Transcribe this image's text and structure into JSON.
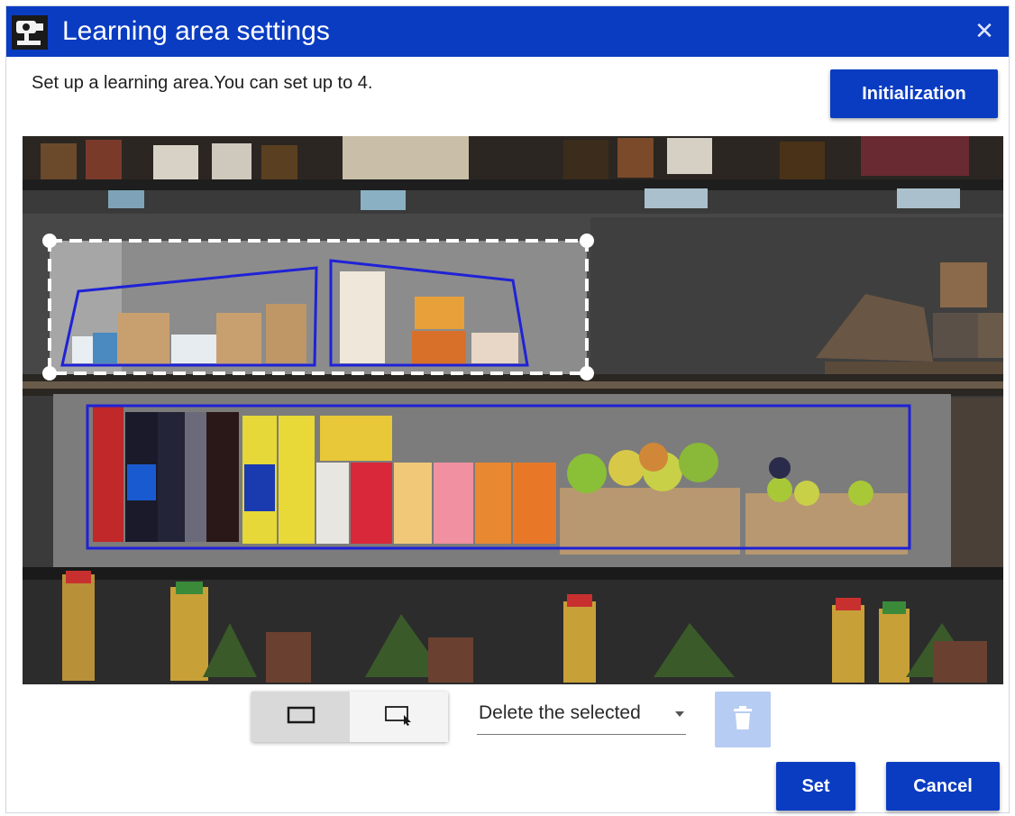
{
  "window": {
    "title": "Learning area settings",
    "close_icon": "close-icon",
    "app_icon": "camera-settings-icon"
  },
  "instruction": "Set up a learning area.You can set up to 4.",
  "buttons": {
    "initialization": "Initialization",
    "set": "Set",
    "cancel": "Cancel"
  },
  "canvas": {
    "image": "store-shelf-camera-view",
    "regions": [
      {
        "name": "learning-area-1",
        "shape": "polygon",
        "color": "#1f22d6"
      },
      {
        "name": "learning-area-2",
        "shape": "polygon",
        "color": "#1f22d6"
      },
      {
        "name": "learning-area-3",
        "shape": "rectangle",
        "color": "#1f22d6"
      },
      {
        "name": "selection-box",
        "shape": "dashed-rectangle",
        "color": "#ffffff",
        "selected": true
      }
    ]
  },
  "toolbar": {
    "rect_tool_icon": "rectangle-icon",
    "select_tool_icon": "select-region-icon",
    "active_tool": "rectangle",
    "dropdown_value": "Delete the selected",
    "trash_icon": "trash-icon",
    "trash_enabled": false
  },
  "colors": {
    "accent": "#0a3cc2",
    "region_outline": "#1f22d6",
    "disabled_button": "#b7ccf2"
  }
}
